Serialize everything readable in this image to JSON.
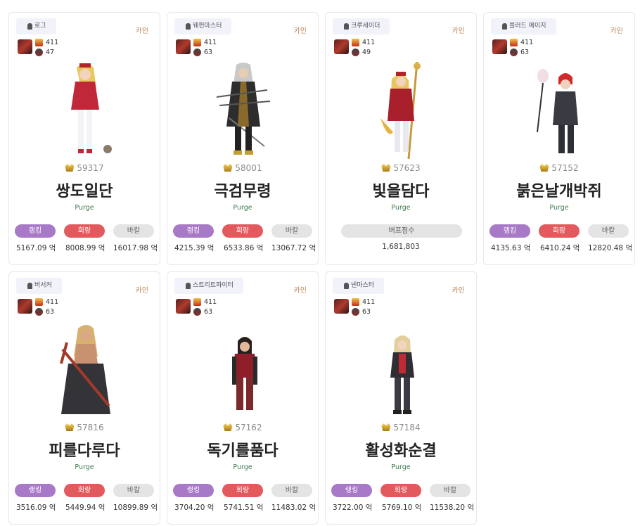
{
  "unit": "억",
  "labels": {
    "ranking": "랭킹",
    "cycle": "회랑",
    "balance": "바칼",
    "buff": "버프점수"
  },
  "cards": [
    {
      "job": "로그",
      "server": "카인",
      "level": "411",
      "sub_level": "47",
      "fame": "59317",
      "name": "쌍도일단",
      "guild": "Purge",
      "rank_val": "5167.09 억",
      "cycle_val": "8008.99 억",
      "bal_val": "16017.98 억"
    },
    {
      "job": "웨펀마스터",
      "server": "카인",
      "level": "411",
      "sub_level": "63",
      "fame": "58001",
      "name": "극검무령",
      "guild": "Purge",
      "rank_val": "4215.39 억",
      "cycle_val": "6533.86 억",
      "bal_val": "13067.72 억"
    },
    {
      "job": "크루세이더",
      "server": "카인",
      "level": "411",
      "sub_level": "49",
      "fame": "57623",
      "name": "빛을담다",
      "guild": "Purge",
      "buff_val": "1,681,803"
    },
    {
      "job": "블러드 메이지",
      "server": "카인",
      "level": "411",
      "sub_level": "63",
      "fame": "57152",
      "name": "붉은날개박쥐",
      "guild": "Purge",
      "rank_val": "4135.63 억",
      "cycle_val": "6410.24 억",
      "bal_val": "12820.48 억"
    },
    {
      "job": "버서커",
      "server": "카인",
      "level": "411",
      "sub_level": "63",
      "fame": "57816",
      "name": "피를다루다",
      "guild": "Purge",
      "rank_val": "3516.09 억",
      "cycle_val": "5449.94 억",
      "bal_val": "10899.89 억"
    },
    {
      "job": "스트리트파이터",
      "server": "카인",
      "level": "411",
      "sub_level": "63",
      "fame": "57162",
      "name": "독기를품다",
      "guild": "Purge",
      "rank_val": "3704.20 억",
      "cycle_val": "5741.51 억",
      "bal_val": "11483.02 억"
    },
    {
      "job": "넨마스터",
      "server": "카인",
      "level": "411",
      "sub_level": "63",
      "fame": "57184",
      "name": "활성화순결",
      "guild": "Purge",
      "rank_val": "3722.00 억",
      "cycle_val": "5769.10 억",
      "bal_val": "11538.20 억"
    }
  ]
}
